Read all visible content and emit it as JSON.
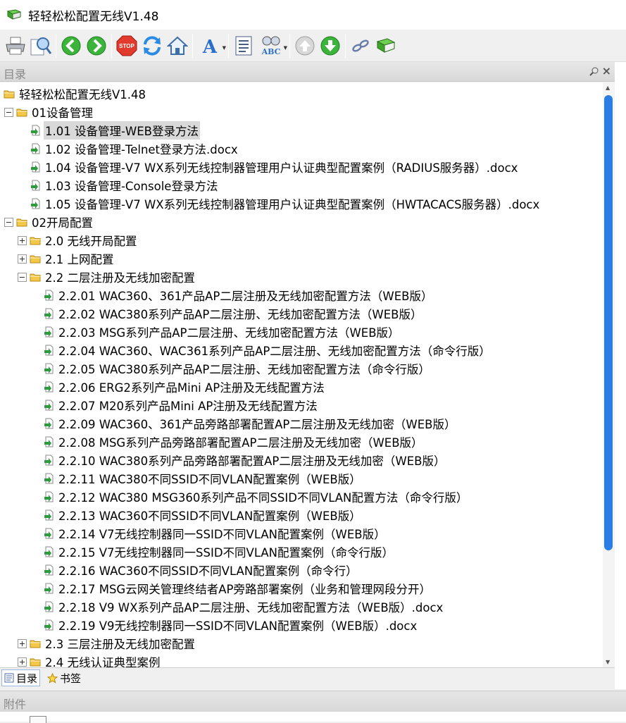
{
  "window": {
    "title": "轻轻松松配置无线V1.48"
  },
  "toolbar": {
    "buttons": [
      "print-icon",
      "find-icon",
      "back-icon",
      "forward-icon",
      "stop-icon",
      "refresh-icon",
      "home-icon",
      "font-icon",
      "contents-icon",
      "spelling-icon",
      "up-icon",
      "down-icon",
      "link-icon",
      "book-icon"
    ],
    "stop_label": "STOP",
    "font_letter": "A",
    "abc_label": "ABC"
  },
  "toc_panel": {
    "title": "目录",
    "close_glyph": "×"
  },
  "tree": {
    "items": [
      {
        "type": "folder",
        "level": 0,
        "label": "轻轻松松配置无线V1.48",
        "toggle": "none"
      },
      {
        "type": "folder",
        "level": 0,
        "label": "01设备管理",
        "toggle": "minus"
      },
      {
        "type": "doc",
        "level": 1,
        "label": "1.01 设备管理-WEB登录方法",
        "selected": true
      },
      {
        "type": "doc",
        "level": 1,
        "label": "1.02 设备管理-Telnet登录方法.docx"
      },
      {
        "type": "doc",
        "level": 1,
        "label": "1.04 设备管理-V7 WX系列无线控制器管理用户认证典型配置案例（RADIUS服务器）.docx"
      },
      {
        "type": "doc",
        "level": 1,
        "label": "1.03 设备管理-Console登录方法"
      },
      {
        "type": "doc",
        "level": 1,
        "label": "1.05 设备管理-V7 WX系列无线控制器管理用户认证典型配置案例（HWTACACS服务器）.docx"
      },
      {
        "type": "folder",
        "level": 0,
        "label": "02开局配置",
        "toggle": "minus"
      },
      {
        "type": "folder",
        "level": 1,
        "label": "2.0 无线开局配置",
        "toggle": "plus"
      },
      {
        "type": "folder",
        "level": 1,
        "label": "2.1 上网配置",
        "toggle": "plus"
      },
      {
        "type": "folder",
        "level": 1,
        "label": "2.2 二层注册及无线加密配置",
        "toggle": "minus"
      },
      {
        "type": "doc",
        "level": 2,
        "label": "2.2.01 WAC360、361产品AP二层注册及无线加密配置方法（WEB版）"
      },
      {
        "type": "doc",
        "level": 2,
        "label": "2.2.02 WAC380系列产品AP二层注册、无线加密配置方法（WEB版）"
      },
      {
        "type": "doc",
        "level": 2,
        "label": "2.2.03 MSG系列产品AP二层注册、无线加密配置方法（WEB版）"
      },
      {
        "type": "doc",
        "level": 2,
        "label": "2.2.04 WAC360、WAC361系列产品AP二层注册、无线加密配置方法（命令行版）"
      },
      {
        "type": "doc",
        "level": 2,
        "label": "2.2.05 WAC380系列产品AP二层注册、无线加密配置方法（命令行版）"
      },
      {
        "type": "doc",
        "level": 2,
        "label": "2.2.06 ERG2系列产品Mini AP注册及无线配置方法"
      },
      {
        "type": "doc",
        "level": 2,
        "label": "2.2.07 M20系列产品Mini AP注册及无线配置方法"
      },
      {
        "type": "doc",
        "level": 2,
        "label": "2.2.09 WAC360、361产品旁路部署配置AP二层注册及无线加密（WEB版）"
      },
      {
        "type": "doc",
        "level": 2,
        "label": "2.2.08 MSG系列产品旁路部署配置AP二层注册及无线加密（WEB版）"
      },
      {
        "type": "doc",
        "level": 2,
        "label": "2.2.10 WAC380系列产品旁路部署配置AP二层注册及无线加密（WEB版）"
      },
      {
        "type": "doc",
        "level": 2,
        "label": "2.2.11 WAC380不同SSID不同VLAN配置案例（WEB版）"
      },
      {
        "type": "doc",
        "level": 2,
        "label": "2.2.12 WAC380 MSG360系列产品不同SSID不同VLAN配置方法（命令行版）"
      },
      {
        "type": "doc",
        "level": 2,
        "label": "2.2.13 WAC360不同SSID不同VLAN配置案例（WEB版）"
      },
      {
        "type": "doc",
        "level": 2,
        "label": "2.2.14 V7无线控制器同一SSID不同VLAN配置案例（WEB版）"
      },
      {
        "type": "doc",
        "level": 2,
        "label": "2.2.15 V7无线控制器同一SSID不同VLAN配置案例（命令行版）"
      },
      {
        "type": "doc",
        "level": 2,
        "label": "2.2.16 WAC360不同SSID不同VLAN配置案例（命令行）"
      },
      {
        "type": "doc",
        "level": 2,
        "label": "2.2.17 MSG云网关管理终结者AP旁路部署案例（业务和管理网段分开）"
      },
      {
        "type": "doc",
        "level": 2,
        "label": "2.2.18 V9 WX系列产品AP二层注册、无线加密配置方法（WEB版）.docx"
      },
      {
        "type": "doc",
        "level": 2,
        "label": "2.2.19 V9无线控制器同一SSID不同VLAN配置案例（WEB版）.docx"
      },
      {
        "type": "folder",
        "level": 1,
        "label": "2.3 三层注册及无线加密配置",
        "toggle": "plus"
      },
      {
        "type": "folder",
        "level": 1,
        "label": "2.4 无线认证典型案例",
        "toggle": "plus"
      }
    ]
  },
  "tabs": [
    {
      "label": "目录",
      "active": true,
      "icon": "toc-icon"
    },
    {
      "label": "书签",
      "active": false,
      "icon": "star-icon"
    }
  ],
  "attachments": {
    "title": "附件"
  },
  "colors": {
    "accent": "#2a7ee3",
    "folder": "#f2c84b",
    "doc_arrow": "#2e9a3e",
    "selected_bg": "#d9d9d9"
  }
}
